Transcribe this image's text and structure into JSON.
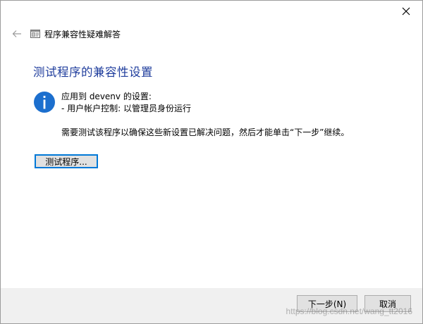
{
  "nav": {
    "title": "程序兼容性疑难解答"
  },
  "main": {
    "heading": "测试程序的兼容性设置",
    "info_line1": "应用到 devenv 的设置:",
    "info_line2": "- 用户帐户控制: 以管理员身份运行",
    "instruction": "需要测试该程序以确保这些新设置已解决问题，然后才能单击“下一步”继续。",
    "test_button": "测试程序..."
  },
  "footer": {
    "next_button": "下一步(N)",
    "cancel_button": "取消"
  },
  "watermark": "https://blog.csdn.net/wang_tt2016",
  "icons": {
    "close": "close-icon",
    "back": "back-arrow-icon",
    "app": "app-icon",
    "info": "info-icon"
  },
  "colors": {
    "heading": "#1e3c9c",
    "info_icon": "#1c6fce",
    "focus_border": "#0078d7",
    "footer_bg": "#f0f0f0"
  }
}
